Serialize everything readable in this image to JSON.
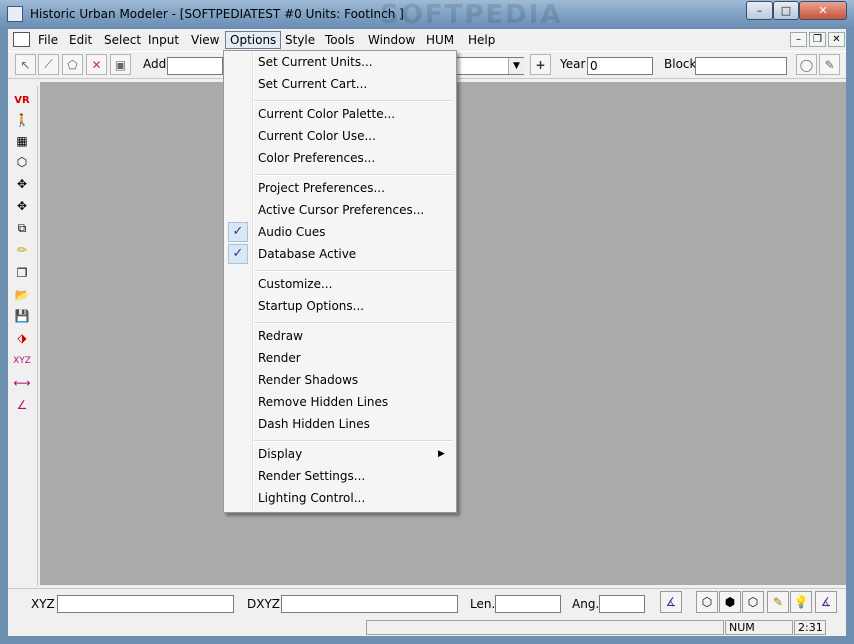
{
  "window": {
    "title": "Historic Urban Modeler - [SOFTPEDIATEST #0  Units: FootInch ]",
    "watermark": "SOFTPEDIA",
    "controls": {
      "minimize": "–",
      "maximize": "□",
      "close": "✕"
    }
  },
  "menubar": {
    "items": [
      "File",
      "Edit",
      "Select",
      "Input",
      "View",
      "Options",
      "Style",
      "Tools",
      "Window",
      "HUM",
      "Help"
    ],
    "active": "Options",
    "mdi": {
      "minimize": "–",
      "restore": "❐",
      "close": "✕"
    }
  },
  "toolbar": {
    "add_label": "Add",
    "add_value": "",
    "year_label": "Year",
    "year_value": "0",
    "block_label": "Block",
    "block_value": "",
    "plus_icon": "+"
  },
  "options_menu": {
    "groups": [
      [
        {
          "label": "Set Current Units..."
        },
        {
          "label": "Set Current Cart..."
        }
      ],
      [
        {
          "label": "Current Color Palette..."
        },
        {
          "label": "Current Color Use..."
        },
        {
          "label": "Color Preferences..."
        }
      ],
      [
        {
          "label": "Project Preferences..."
        },
        {
          "label": "Active Cursor Preferences..."
        },
        {
          "label": "Audio Cues",
          "checked": true
        },
        {
          "label": "Database Active",
          "checked": true
        }
      ],
      [
        {
          "label": "Customize..."
        },
        {
          "label": "Startup Options..."
        }
      ],
      [
        {
          "label": "Redraw"
        },
        {
          "label": "Render"
        },
        {
          "label": "Render Shadows"
        },
        {
          "label": "Remove Hidden Lines"
        },
        {
          "label": "Dash Hidden Lines"
        }
      ],
      [
        {
          "label": "Display",
          "submenu": true
        },
        {
          "label": "Render Settings..."
        },
        {
          "label": "Lighting Control..."
        }
      ]
    ],
    "check_glyph": "✓",
    "submenu_glyph": "▶"
  },
  "left_tools": {
    "vr_label": "VR",
    "xyz_label": "XYZ"
  },
  "bottombar": {
    "xyz_label": "XYZ",
    "xyz_value": "",
    "dxyz_label": "DXYZ",
    "dxyz_value": "",
    "len_label": "Len.",
    "len_value": "",
    "ang_label": "Ang.",
    "ang_value": ""
  },
  "statusbar": {
    "num": "NUM",
    "time": "2:31"
  }
}
